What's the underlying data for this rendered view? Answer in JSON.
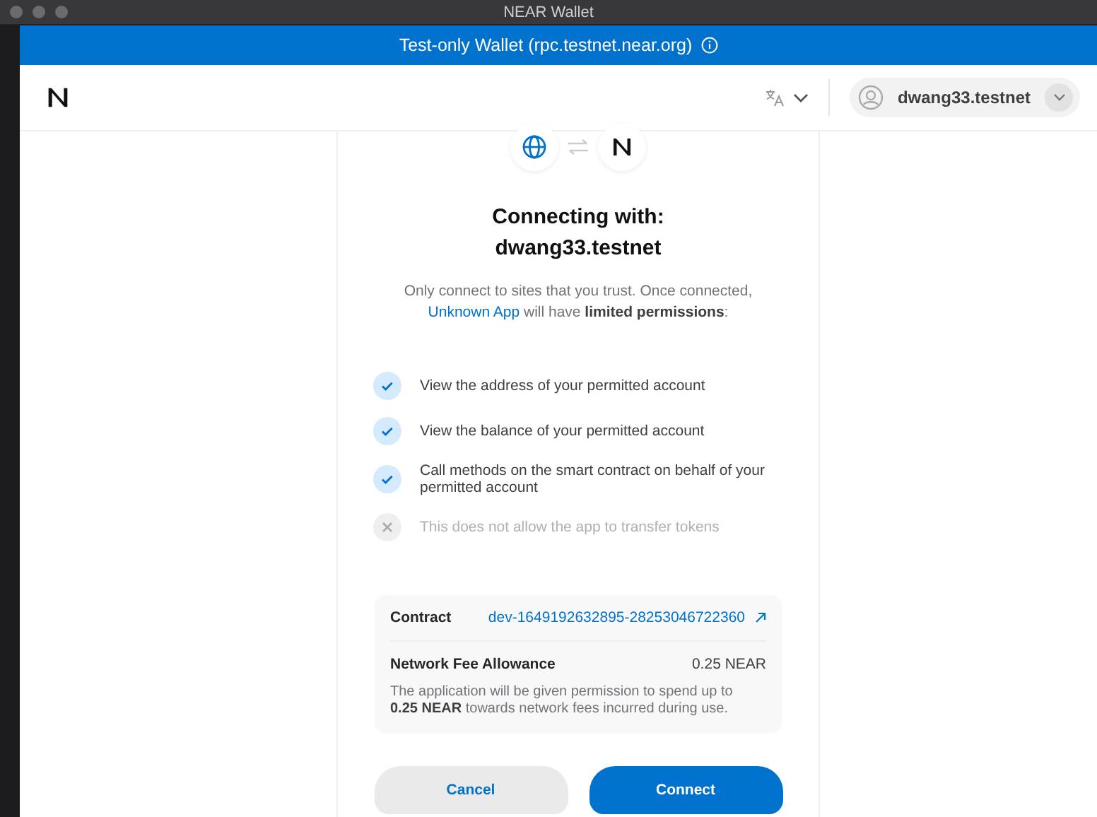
{
  "window": {
    "title": "NEAR Wallet"
  },
  "banner": {
    "text": "Test-only Wallet (rpc.testnet.near.org)"
  },
  "header": {
    "account": "dwang33.testnet"
  },
  "heading": [
    "Connecting with:",
    "dwang33.testnet"
  ],
  "intro": {
    "before": "Only connect to sites that you trust. Once connected,",
    "app": "Unknown App",
    "after": "will have **limited permissions**:"
  },
  "permissions": [
    {
      "text": "View the address of your permitted account",
      "allowed": true
    },
    {
      "text": "View the balance of your permitted account",
      "allowed": true
    },
    {
      "text": "Call methods on the smart contract on behalf of your permitted account",
      "allowed": true
    },
    {
      "text": "This does not allow the app to transfer tokens",
      "allowed": false
    }
  ],
  "contract": {
    "label": "Contract",
    "value": "dev-1649192632895-28253046722360"
  },
  "fee": {
    "label": "Network Fee Allowance",
    "value": "0.25 NEAR",
    "note": "The application will be given permission to spend up to **0.25 NEAR** towards network fees incurred during use."
  },
  "buttons": [
    {
      "label": "Cancel",
      "kind": "secondary"
    },
    {
      "label": "Connect",
      "kind": "primary"
    }
  ]
}
